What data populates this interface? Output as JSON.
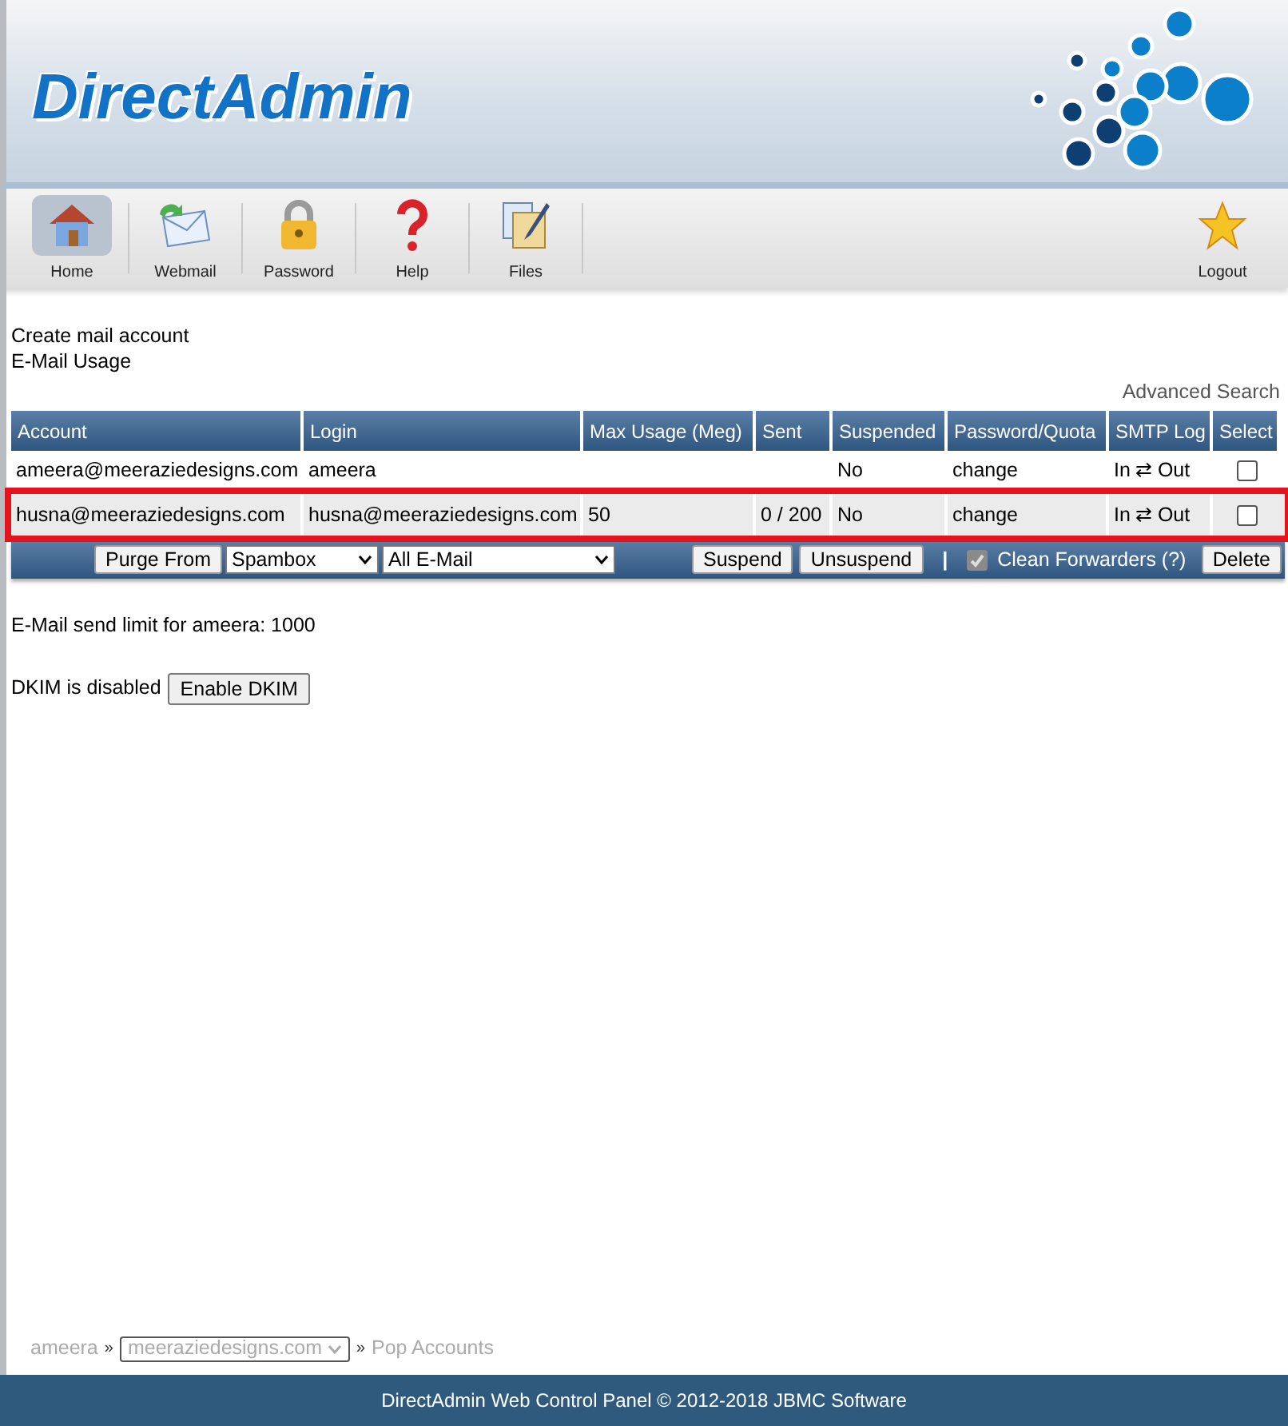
{
  "logo": {
    "text": "DirectAdmin"
  },
  "toolbar": [
    {
      "label": "Home",
      "kind": "home",
      "selected": true
    },
    {
      "label": "Webmail",
      "kind": "mail",
      "selected": false
    },
    {
      "label": "Password",
      "kind": "lock",
      "selected": false
    },
    {
      "label": "Help",
      "kind": "help",
      "selected": false
    },
    {
      "label": "Files",
      "kind": "files",
      "selected": false
    }
  ],
  "logout": {
    "label": "Logout"
  },
  "links": [
    "Create mail account",
    "E-Mail Usage"
  ],
  "advanced_search": "Advanced Search",
  "table": {
    "columns": [
      "Account",
      "Login",
      "Max Usage (Meg)",
      "Sent",
      "Suspended",
      "Password/Quota",
      "SMTP Log",
      "Select"
    ],
    "rows": [
      {
        "account": "ameera@meeraziedesigns.com",
        "login": "ameera",
        "max_usage": "",
        "sent": "",
        "suspended": "No",
        "password": "change",
        "smtp_in": "In",
        "smtp_arrow": "⇄",
        "smtp_out": "Out",
        "checked": false,
        "highlighted": false
      },
      {
        "account": "husna@meeraziedesigns.com",
        "login": "husna@meeraziedesigns.com",
        "max_usage": "50",
        "sent": "0 / 200",
        "suspended": "No",
        "password": "change",
        "smtp_in": "In",
        "smtp_arrow": "⇄",
        "smtp_out": "Out",
        "checked": false,
        "highlighted": true
      }
    ]
  },
  "actions": {
    "purge": "Purge From",
    "folder": "Spambox",
    "scope": "All E-Mail",
    "suspend": "Suspend",
    "unsuspend": "Unsuspend",
    "separator": "|",
    "clean_forwarders": {
      "label": "Clean Forwarders (?)",
      "checked": true,
      "disabled": true
    },
    "delete": "Delete"
  },
  "send_limit": "E-Mail send limit for ameera: 1000",
  "dkim": {
    "text": "DKIM is disabled",
    "button": "Enable DKIM"
  },
  "breadcrumb": {
    "user": "ameera",
    "sep1": "»",
    "domain": "meeraziedesigns.com",
    "sep2": "»",
    "page": "Pop Accounts"
  },
  "footer": "DirectAdmin Web Control Panel © 2012-2018 JBMC Software"
}
